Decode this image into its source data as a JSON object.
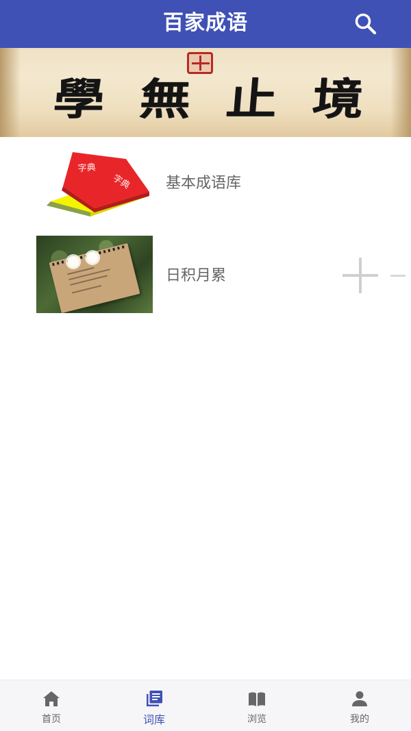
{
  "app": {
    "title": "百家成语"
  },
  "banner": {
    "characters": [
      "學",
      "無",
      "止",
      "境"
    ]
  },
  "book_thumbnail": {
    "text_left": "字典",
    "text_right": "字典"
  },
  "list": {
    "items": [
      {
        "label": "基本成语库",
        "thumbnail": "red-dictionary-book"
      },
      {
        "label": "日积月累",
        "thumbnail": "notebook-on-grass-photo",
        "action_icon": "plus-icon"
      }
    ]
  },
  "bottom_nav": {
    "tabs": [
      {
        "label": "首页",
        "icon": "home-icon",
        "active": false
      },
      {
        "label": "词库",
        "icon": "library-icon",
        "active": true
      },
      {
        "label": "浏览",
        "icon": "book-open-icon",
        "active": false
      },
      {
        "label": "我的",
        "icon": "person-icon",
        "active": false
      }
    ]
  },
  "colors": {
    "primary": "#3f51b5",
    "book_red": "#e8262a",
    "book_yellow": "#f4f400",
    "text_gray": "#666666"
  }
}
